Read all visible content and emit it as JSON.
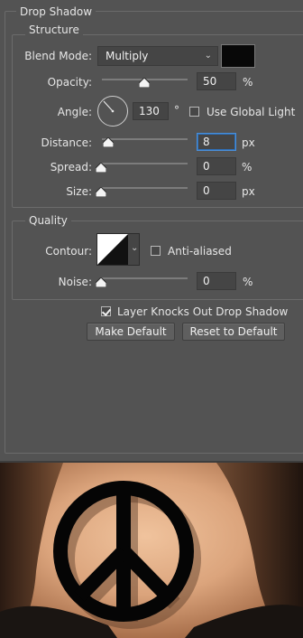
{
  "panel": {
    "title": "Drop Shadow",
    "structure": {
      "title": "Structure",
      "blend_mode_label": "Blend Mode:",
      "blend_mode_value": "Multiply",
      "shadow_color": "#080808",
      "opacity_label": "Opacity:",
      "opacity_value": "50",
      "opacity_unit": "%",
      "opacity_level": 0.5,
      "angle_label": "Angle:",
      "angle_value": "130",
      "angle_unit": "°",
      "use_global_light_label": "Use Global Light",
      "use_global_light_checked": false,
      "distance_label": "Distance:",
      "distance_value": "8",
      "distance_unit": "px",
      "spread_label": "Spread:",
      "spread_value": "0",
      "spread_unit": "%",
      "size_label": "Size:",
      "size_value": "0",
      "size_unit": "px"
    },
    "quality": {
      "title": "Quality",
      "contour_label": "Contour:",
      "anti_aliased_label": "Anti-aliased",
      "anti_aliased_checked": false,
      "noise_label": "Noise:",
      "noise_value": "0",
      "noise_unit": "%"
    },
    "layer_knocks_out_label": "Layer Knocks Out Drop Shadow",
    "layer_knocks_out_checked": true,
    "make_default_label": "Make Default",
    "reset_default_label": "Reset to Default"
  },
  "colors": {
    "panel_bg": "#535353",
    "field_bg": "#454545",
    "focus_border": "#4a8fd8",
    "peace_symbol": "#050505",
    "skin": "#e2b08a",
    "hair": "#3a2518"
  },
  "preview": {
    "icon": "peace-symbol-icon"
  }
}
